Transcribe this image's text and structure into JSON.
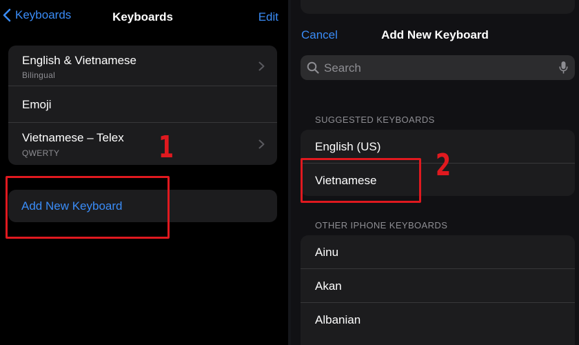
{
  "left": {
    "nav": {
      "back_label": "Keyboards",
      "title": "Keyboards",
      "edit_label": "Edit"
    },
    "keyboards": [
      {
        "title": "English & Vietnamese",
        "subtitle": "Bilingual"
      },
      {
        "title": "Emoji"
      },
      {
        "title": "Vietnamese – Telex",
        "subtitle": "QWERTY"
      }
    ],
    "add_label": "Add New Keyboard",
    "step_label": "1"
  },
  "right": {
    "cancel_label": "Cancel",
    "title": "Add New Keyboard",
    "search_placeholder": "Search",
    "suggested_header": "SUGGESTED KEYBOARDS",
    "suggested": [
      "English (US)",
      "Vietnamese"
    ],
    "other_header": "OTHER IPHONE KEYBOARDS",
    "other": [
      "Ainu",
      "Akan",
      "Albanian"
    ],
    "step_label": "2"
  },
  "colors": {
    "accent": "#3a8cf7",
    "highlight": "#e0191f",
    "cell": "#1c1c1e",
    "secondary_text": "#8e8e93"
  }
}
